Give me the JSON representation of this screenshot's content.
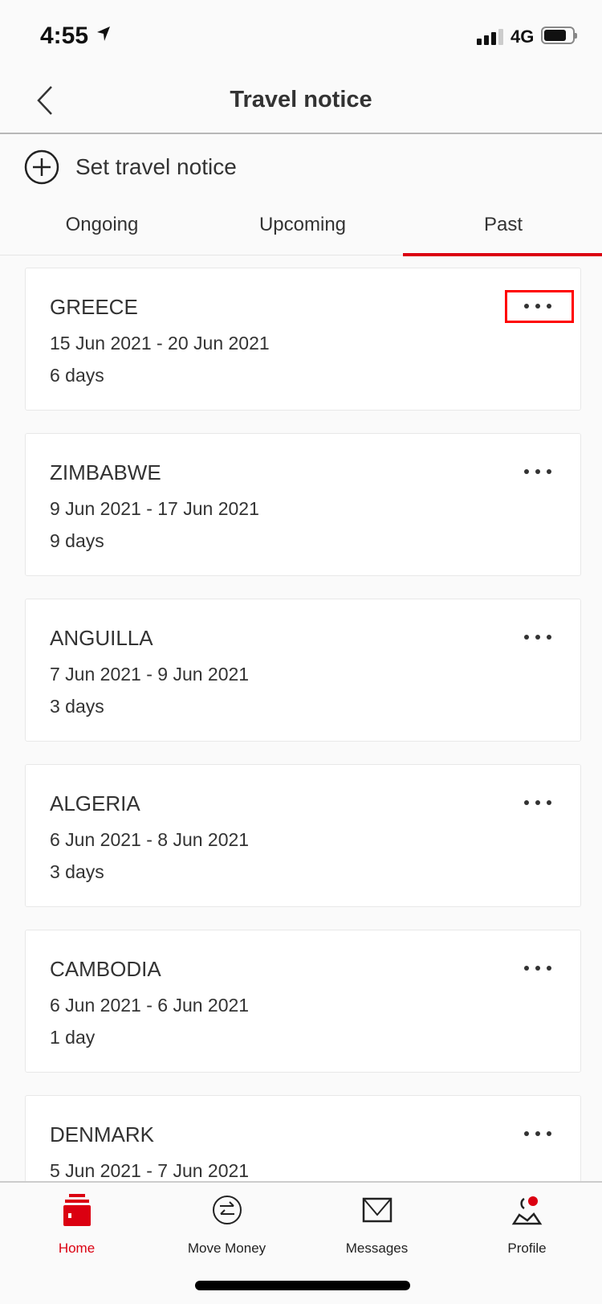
{
  "status_bar": {
    "time": "4:55",
    "network": "4G",
    "battery_level": 0.8
  },
  "header": {
    "title": "Travel notice",
    "back_icon": "chevron-left-icon"
  },
  "actions": {
    "set_travel_notice": "Set travel notice"
  },
  "tabs": [
    {
      "label": "Ongoing"
    },
    {
      "label": "Upcoming"
    },
    {
      "label": "Past",
      "active": true
    }
  ],
  "notices": [
    {
      "country": "GREECE",
      "dates": "15 Jun 2021 - 20 Jun 2021",
      "duration": "6 days"
    },
    {
      "country": "ZIMBABWE",
      "dates": "9 Jun 2021 - 17 Jun 2021",
      "duration": "9 days"
    },
    {
      "country": "ANGUILLA",
      "dates": "7 Jun 2021 - 9 Jun 2021",
      "duration": "3 days"
    },
    {
      "country": "ALGERIA",
      "dates": "6 Jun 2021 - 8 Jun 2021",
      "duration": "3 days"
    },
    {
      "country": "CAMBODIA",
      "dates": "6 Jun 2021 - 6 Jun 2021",
      "duration": "1 day"
    },
    {
      "country": "DENMARK",
      "dates": "5 Jun 2021 - 7 Jun 2021",
      "duration": ""
    }
  ],
  "bottom_nav": [
    {
      "label": "Home",
      "active": true
    },
    {
      "label": "Move Money"
    },
    {
      "label": "Messages"
    },
    {
      "label": "Profile"
    }
  ],
  "colors": {
    "accent": "#db0011",
    "highlight": "#ff0000"
  }
}
